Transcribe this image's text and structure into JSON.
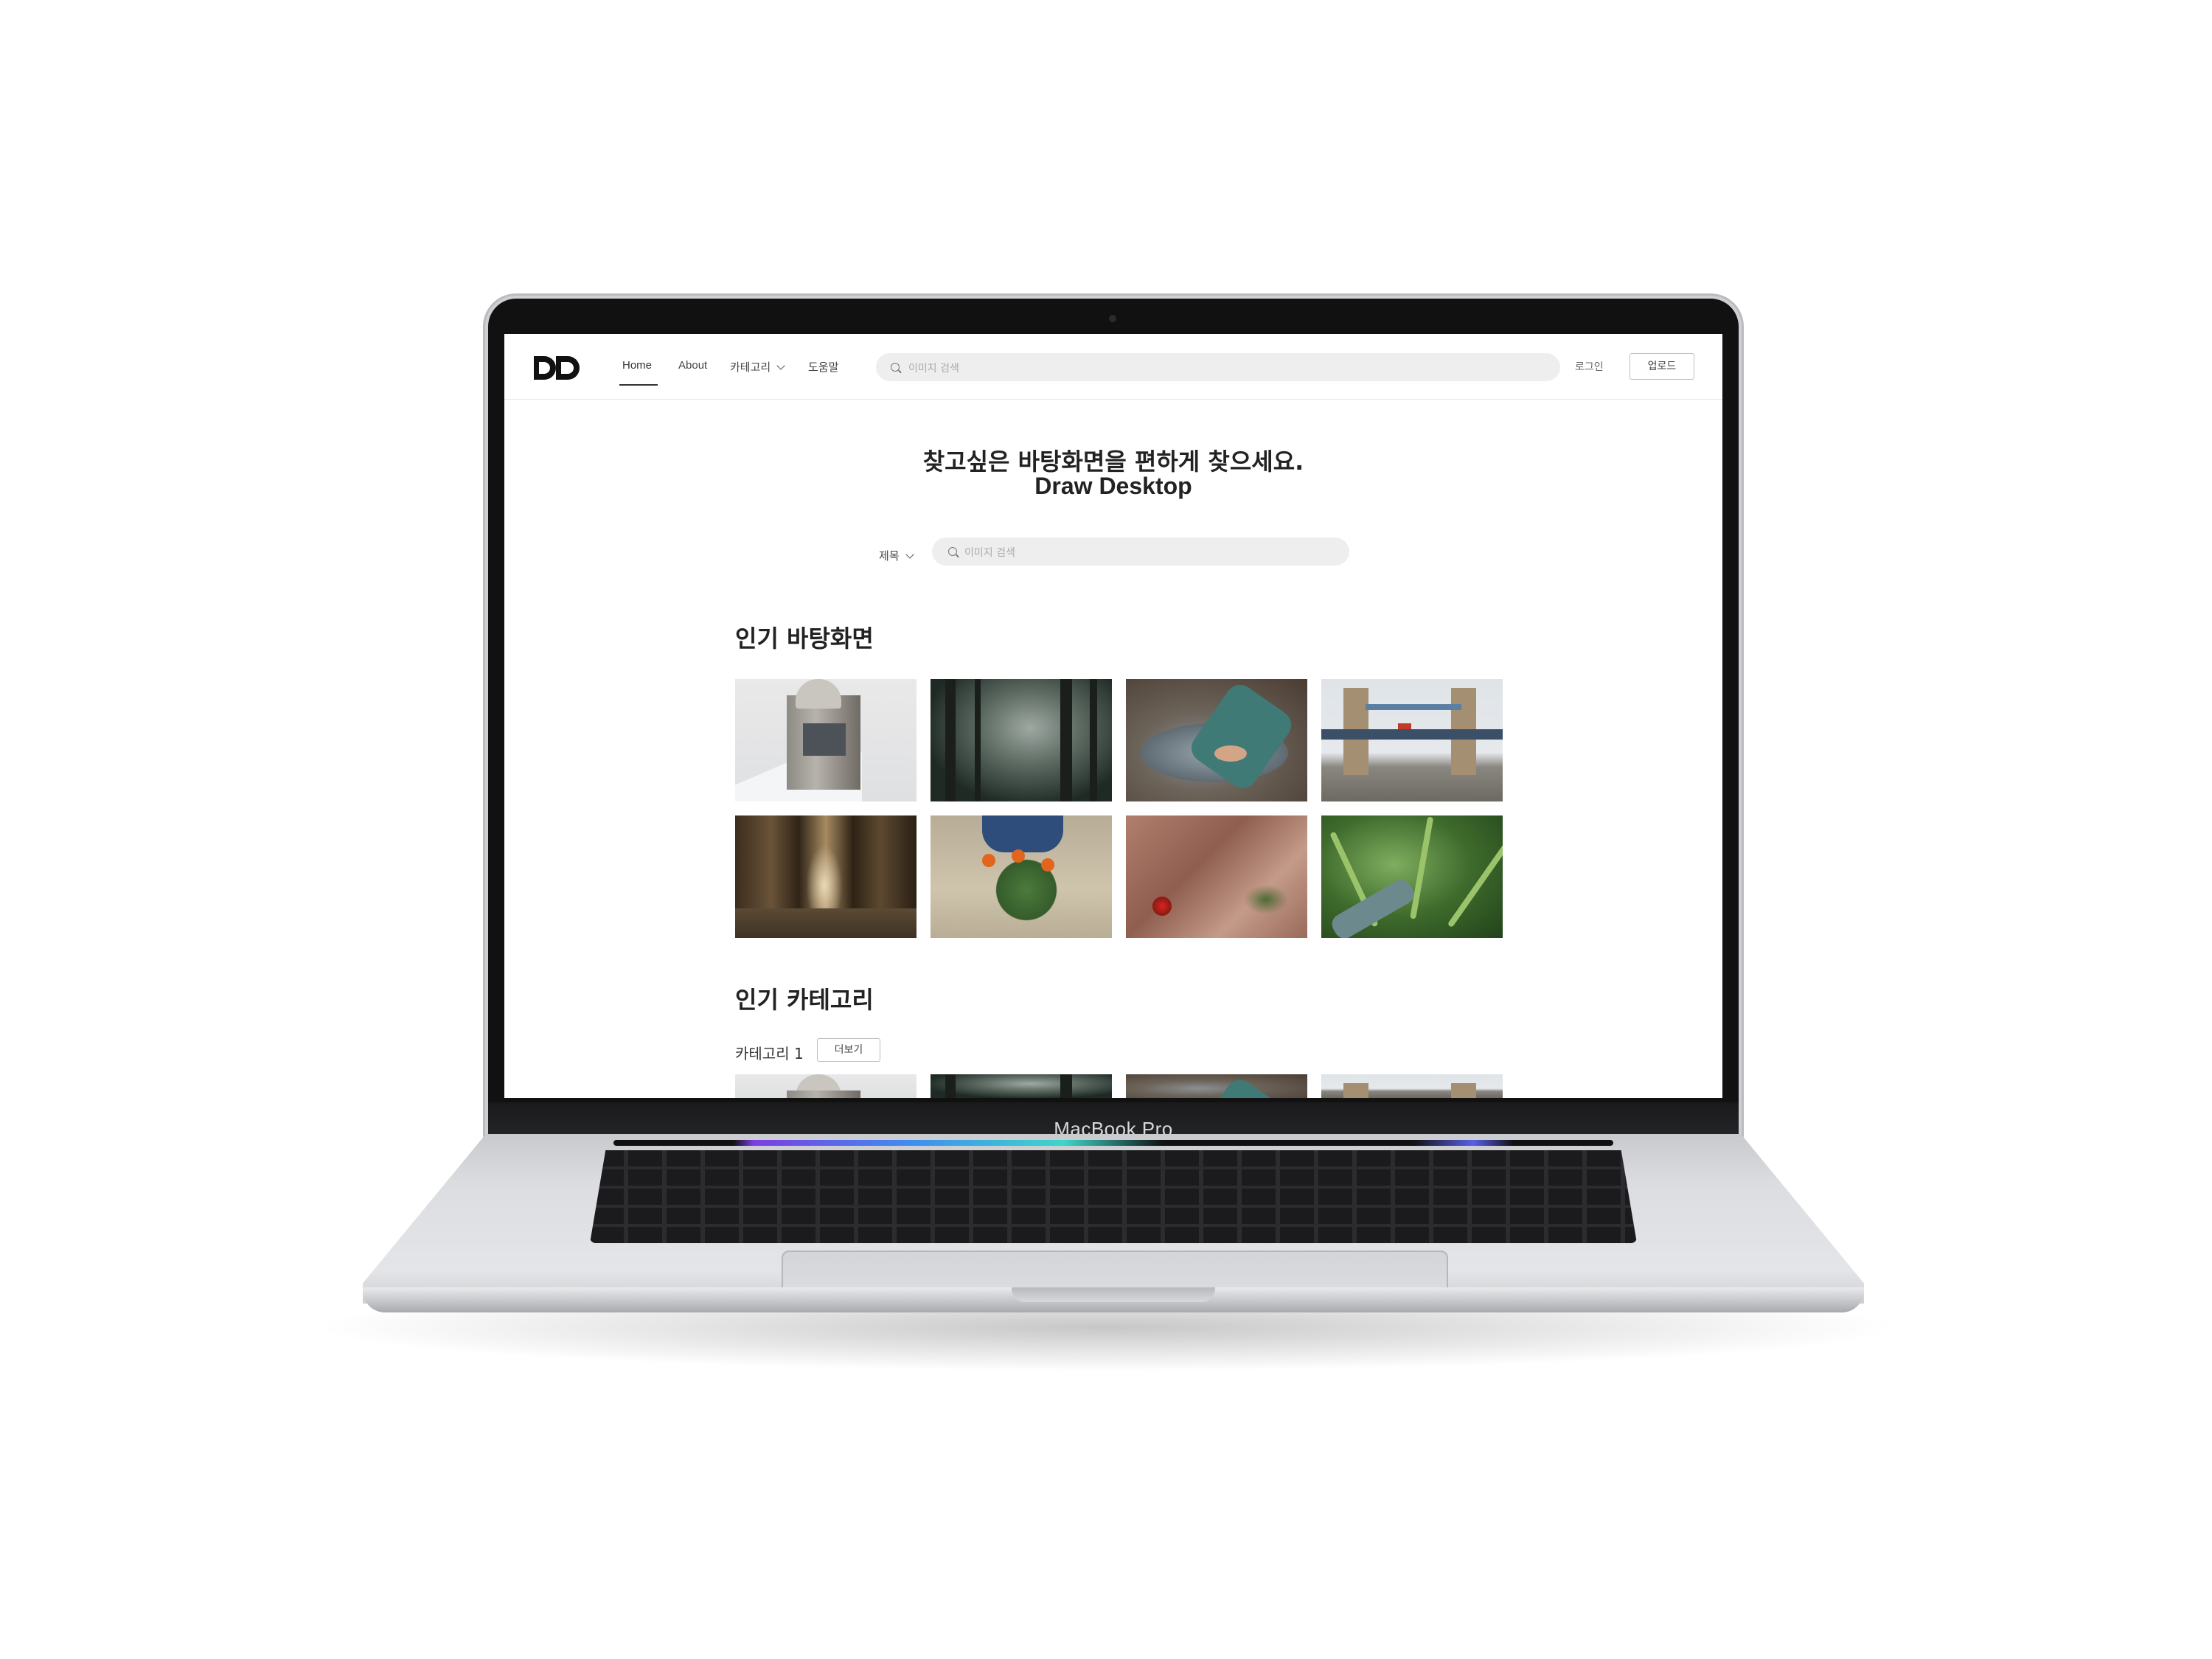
{
  "device": {
    "label": "MacBook Pro"
  },
  "nav": {
    "links": [
      "Home",
      "About",
      "카테고리",
      "도움말"
    ],
    "active": "Home",
    "search_placeholder": "이미지 검색",
    "login": "로그인",
    "upload": "업로드"
  },
  "hero": {
    "line1": "찾고싶은 바탕화면을 편하게 찾으세요.",
    "line2": "Draw Desktop"
  },
  "search": {
    "filter": "제목",
    "placeholder": "이미지 검색"
  },
  "popular_wallpapers": {
    "title": "인기 바탕화면",
    "images": [
      "snowy-observatory",
      "misty-forest",
      "hand-in-stream",
      "tower-bridge",
      "pine-forest",
      "kneeling-with-flowers",
      "red-flower-on-rock",
      "hand-in-palm-leaves"
    ]
  },
  "popular_categories": {
    "title": "인기 카테고리",
    "category_label": "카테고리 1",
    "more_button": "더보기"
  }
}
